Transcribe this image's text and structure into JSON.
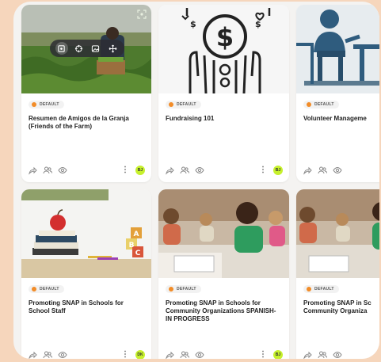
{
  "badge_label": "DEFAULT",
  "accent_color": "#F28C28",
  "avatar_color": "#C6F02C",
  "cards": [
    {
      "title": "Resumen de Amigos de la Granja (Friends of the Farm)",
      "avatar": "BJ"
    },
    {
      "title": "Fundraising 101",
      "avatar": "BJ"
    },
    {
      "title": "Volunteer Manageme",
      "avatar": ""
    },
    {
      "title": "Promoting SNAP in Schools for School Staff",
      "avatar": "DK"
    },
    {
      "title": "Promoting SNAP in Schools for Community Organizations SPANISH-IN PROGRESS",
      "avatar": "BJ"
    },
    {
      "title": "Promoting SNAP in Sc Community Organiza",
      "avatar": ""
    }
  ],
  "image_toolbar": [
    "crop-icon",
    "target-icon",
    "image-icon",
    "move-icon"
  ],
  "footer_icons": [
    "share-icon",
    "users-icon",
    "eye-icon",
    "kebab-menu-icon"
  ]
}
